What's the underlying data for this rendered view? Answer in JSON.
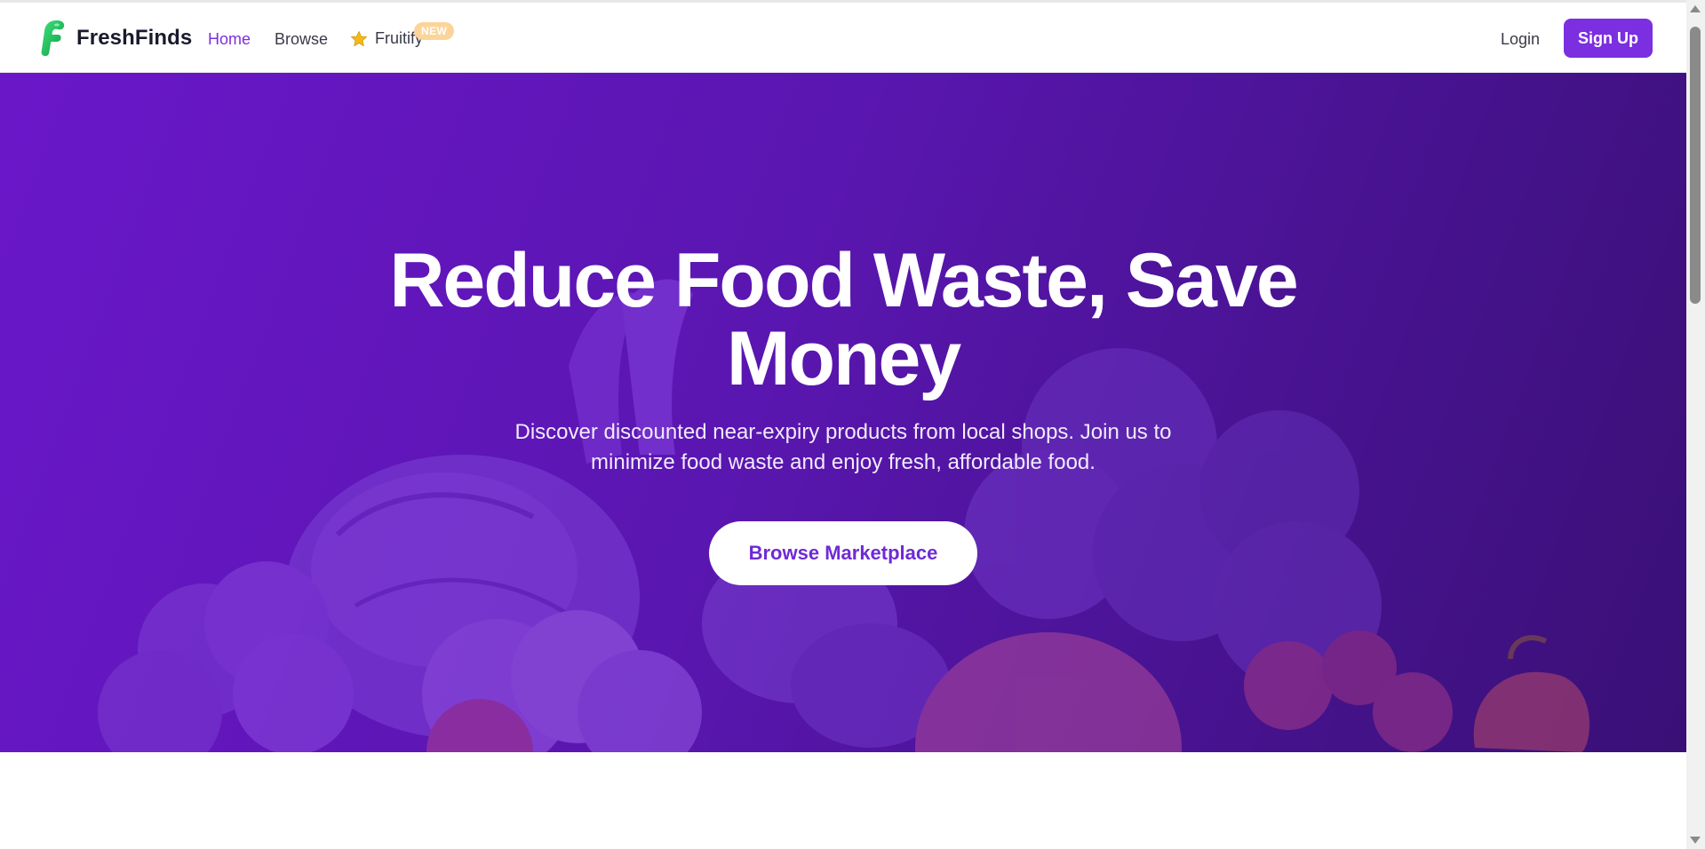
{
  "navbar": {
    "brand_name": "FreshFinds",
    "links": {
      "home": "Home",
      "browse": "Browse",
      "fruitify": "Fruitify"
    },
    "badge": "NEW",
    "login": "Login",
    "signup": "Sign Up",
    "active_link": "Home",
    "icons": {
      "logo": "freshfinds-logo-icon",
      "fruitify": "star-icon"
    }
  },
  "hero": {
    "title_line1": "Reduce Food Waste, Save",
    "title_line2": "Money",
    "subtitle_line1": "Discover discounted near-expiry products from local shops. Join us to",
    "subtitle_line2": "minimize food waste and enjoy fresh, affordable food.",
    "cta": "Browse Marketplace"
  },
  "colors": {
    "accent": "#7b2fe0",
    "hero_gradient_start": "#6a17c9",
    "hero_gradient_end": "#3a1076",
    "badge": "#fcd49a",
    "logo_green": "#1fbf5a"
  }
}
